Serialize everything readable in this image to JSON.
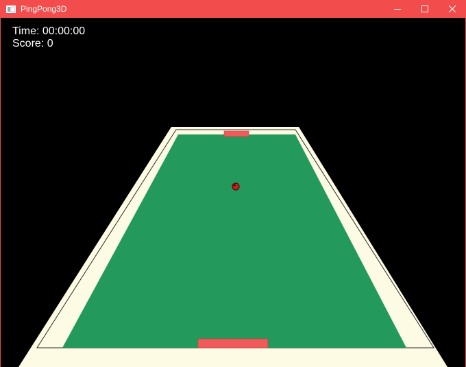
{
  "window": {
    "title": "PingPong3D",
    "app_icon": "window-app-icon",
    "controls": [
      "minimize-icon",
      "maximize-icon",
      "close-icon"
    ],
    "accent": "#f24c4c"
  },
  "hud": {
    "time_label": "Time: 00:00:00",
    "score_label": "Score: 0"
  },
  "scene": {
    "table_color": "#239a5b",
    "rail_color": "#fdfbe3",
    "paddle_color": "#f05a5a",
    "ball_color": "#c81e1e"
  }
}
